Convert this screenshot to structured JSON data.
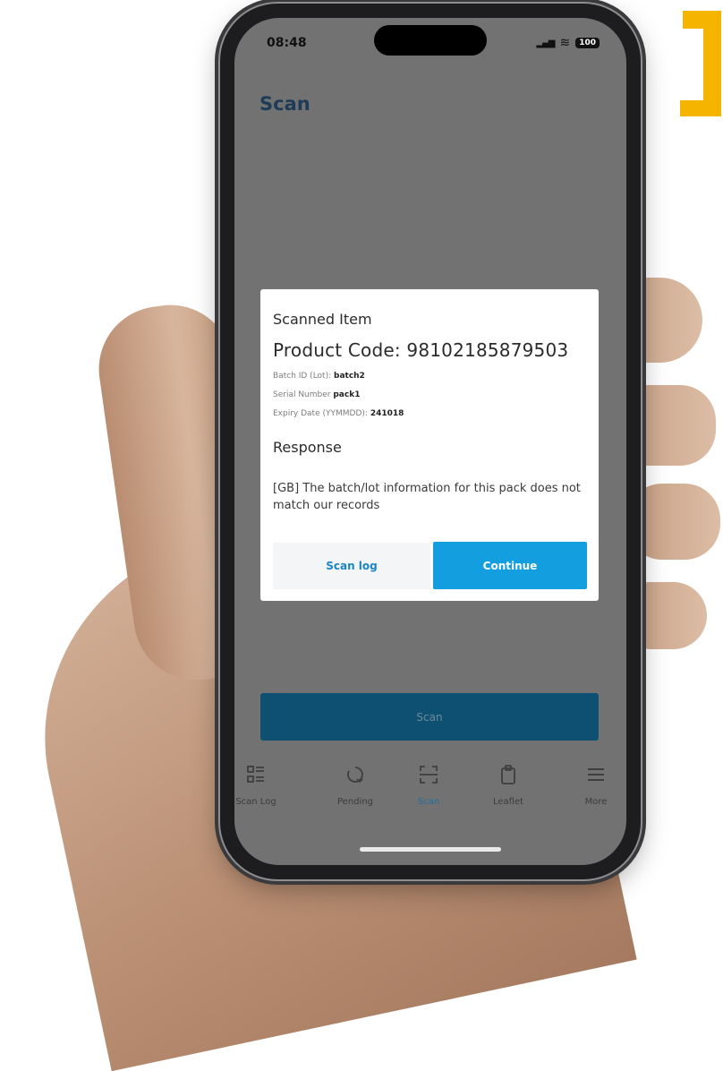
{
  "status_bar": {
    "time": "08:48",
    "battery": "100"
  },
  "page": {
    "title": "Scan"
  },
  "dialog": {
    "heading": "Scanned Item",
    "product_code": "Product Code: 98102185879503",
    "batch_label": "Batch ID (Lot):",
    "batch_value": "batch2",
    "serial_label": "Serial Number",
    "serial_value": "pack1",
    "expiry_label": "Expiry Date (YYMMDD):",
    "expiry_value": "241018",
    "response_title": "Response",
    "response_text": "[GB] The batch/lot information for this pack does not match our records",
    "scan_log_label": "Scan log",
    "continue_label": "Continue"
  },
  "scan_button": {
    "label": "Scan"
  },
  "tabs": [
    {
      "label": "Scan Log",
      "icon": "scan-log-icon"
    },
    {
      "label": "Pending",
      "icon": "pending-icon"
    },
    {
      "label": "Scan",
      "icon": "scan-icon",
      "active": true
    },
    {
      "label": "Leaflet",
      "icon": "leaflet-icon"
    },
    {
      "label": "More",
      "icon": "menu-icon"
    }
  ],
  "colors": {
    "accent": "#139ee0",
    "scan_button": "#0e5071",
    "title": "#1e3c58",
    "overlay": "#727272",
    "decor": "#f5b400"
  }
}
